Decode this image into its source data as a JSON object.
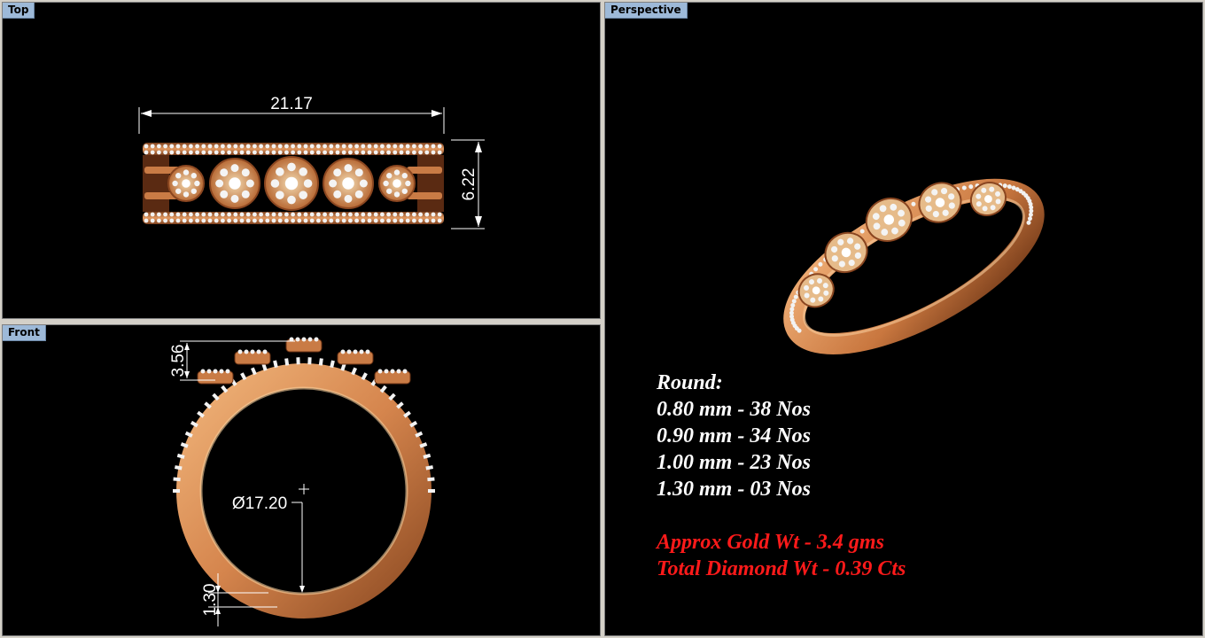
{
  "viewports": {
    "top": {
      "label": "Top",
      "dim_width": "21.17",
      "dim_height": "6.22"
    },
    "front": {
      "label": "Front",
      "dim_height": "3.56",
      "dim_diameter": "Ø17.20",
      "dim_thickness": "1.30"
    },
    "perspective": {
      "label": "Perspective"
    }
  },
  "specs": {
    "heading": "Round:",
    "stones": [
      "0.80 mm - 38 Nos",
      "0.90 mm - 34 Nos",
      "1.00 mm - 23 Nos",
      "1.30 mm - 03 Nos"
    ],
    "gold_weight": "Approx Gold Wt - 3.4 gms",
    "diamond_weight": "Total Diamond Wt - 0.39 Cts"
  },
  "colors": {
    "viewport_bg": "#000000",
    "tab_bg": "#9db9d8",
    "gold": "#d98a52",
    "diamond": "#f2f2f2",
    "weight_text": "#ff1a1a"
  }
}
